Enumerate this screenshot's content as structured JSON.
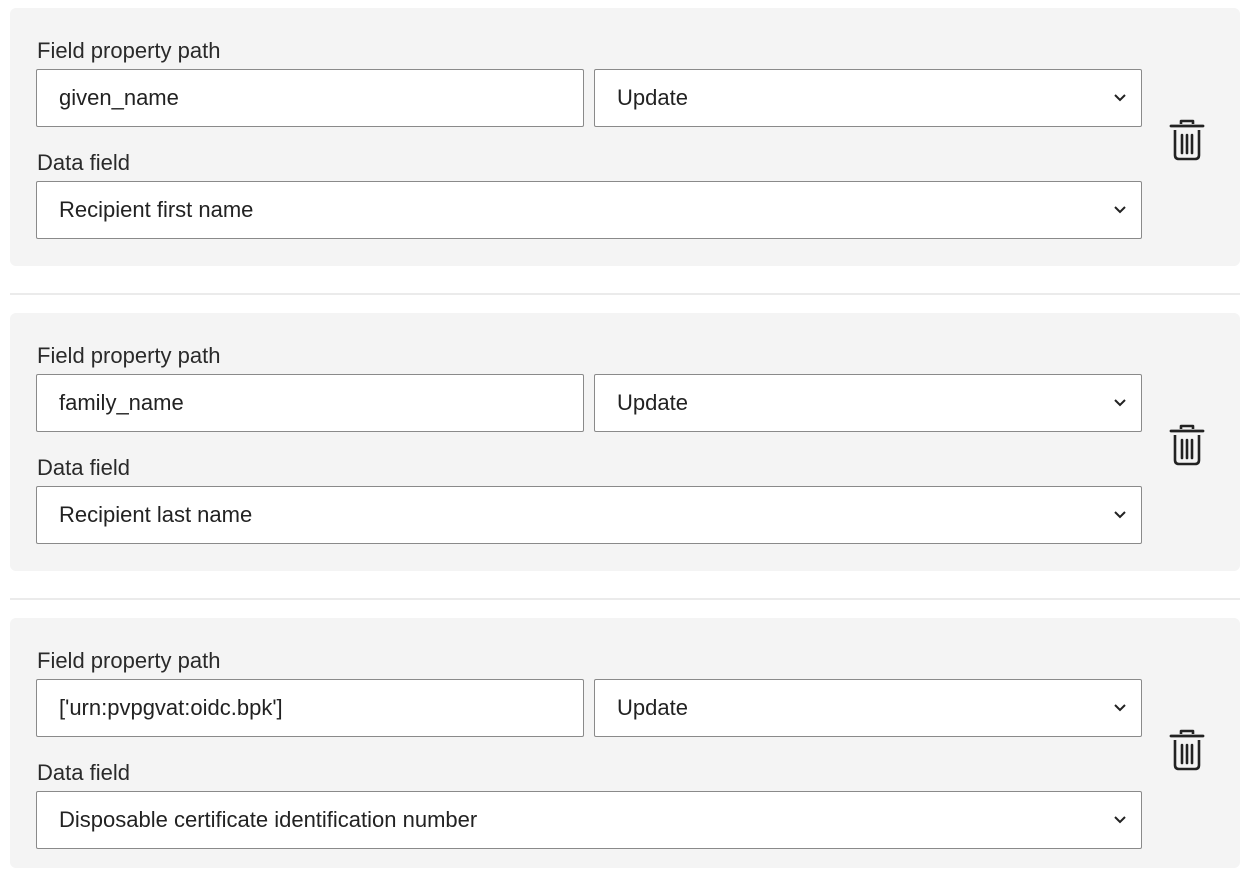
{
  "mappings": [
    {
      "path_label": "Field property path",
      "path_value": "given_name",
      "action_value": "Update",
      "datafield_label": "Data field",
      "datafield_value": "Recipient first name"
    },
    {
      "path_label": "Field property path",
      "path_value": "family_name",
      "action_value": "Update",
      "datafield_label": "Data field",
      "datafield_value": "Recipient last name"
    },
    {
      "path_label": "Field property path",
      "path_value": "['urn:pvpgvat:oidc.bpk']",
      "action_value": "Update",
      "datafield_label": "Data field",
      "datafield_value": "Disposable certificate identification number"
    }
  ],
  "icons": {
    "delete": "trash-icon",
    "dropdown": "chevron-down-icon"
  },
  "colors": {
    "card_background": "#f4f4f4",
    "border": "#8a8a8a",
    "text": "#222222"
  }
}
